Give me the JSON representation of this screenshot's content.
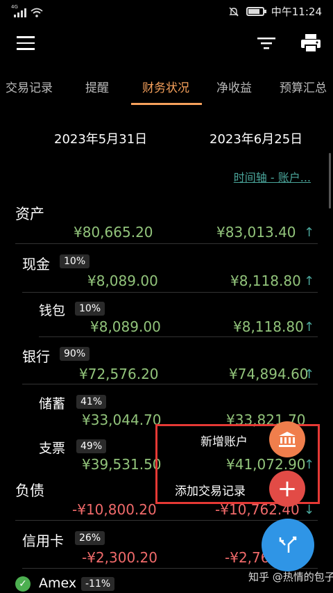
{
  "status_bar": {
    "network": "4G",
    "time": "中午11:24",
    "battery_level": 0.8
  },
  "tabs": [
    {
      "label": "交易记录"
    },
    {
      "label": "提醒"
    },
    {
      "label": "财务状况",
      "active": true
    },
    {
      "label": "净收益"
    },
    {
      "label": "预算汇总"
    }
  ],
  "dates": {
    "left": "2023年5月31日",
    "right": "2023年6月25日"
  },
  "timeline_link": "时间轴 - 账户...",
  "rows": {
    "assets": {
      "label": "资产",
      "v1": "¥80,665.20",
      "v2": "¥83,013.40",
      "arrow": "↑"
    },
    "cash": {
      "label": "现金",
      "pct": "10%",
      "v1": "¥8,089.00",
      "v2": "¥8,118.80",
      "arrow": "↑"
    },
    "wallet": {
      "label": "钱包",
      "pct": "10%",
      "v1": "¥8,089.00",
      "v2": "¥8,118.80",
      "arrow": "↑"
    },
    "bank": {
      "label": "银行",
      "pct": "90%",
      "v1": "¥72,576.20",
      "v2": "¥74,894.60",
      "arrow": "↑"
    },
    "savings": {
      "label": "储蓄",
      "pct": "41%",
      "v1": "¥33,044.70",
      "v2": "¥33,821.70"
    },
    "checks": {
      "label": "支票",
      "pct": "49%",
      "v1": "¥39,531.50",
      "v2": "¥41,072.90",
      "arrow": "↑"
    },
    "liabilities": {
      "label": "负债",
      "v1": "-¥10,800.20",
      "v2": "-¥10,762.40",
      "arrow": "↓"
    },
    "credit": {
      "label": "信用卡",
      "pct": "26%",
      "v1": "-¥2,300.20",
      "v2": "-¥2,76"
    },
    "amex": {
      "label": "Amex",
      "pct": "-11%"
    }
  },
  "fab_menu": {
    "new_account": "新增账户",
    "add_transaction": "添加交易记录"
  },
  "watermark": "知乎 @热情的包子",
  "colors": {
    "accent": "#f6a15c",
    "positive": "#92c47b",
    "negative": "#f06a6a",
    "teal": "#4aa59a",
    "fab_blue": "#2f95e6",
    "fab_orange": "#f07e4c",
    "fab_red": "#e24b46",
    "highlight_box": "#e53935"
  }
}
